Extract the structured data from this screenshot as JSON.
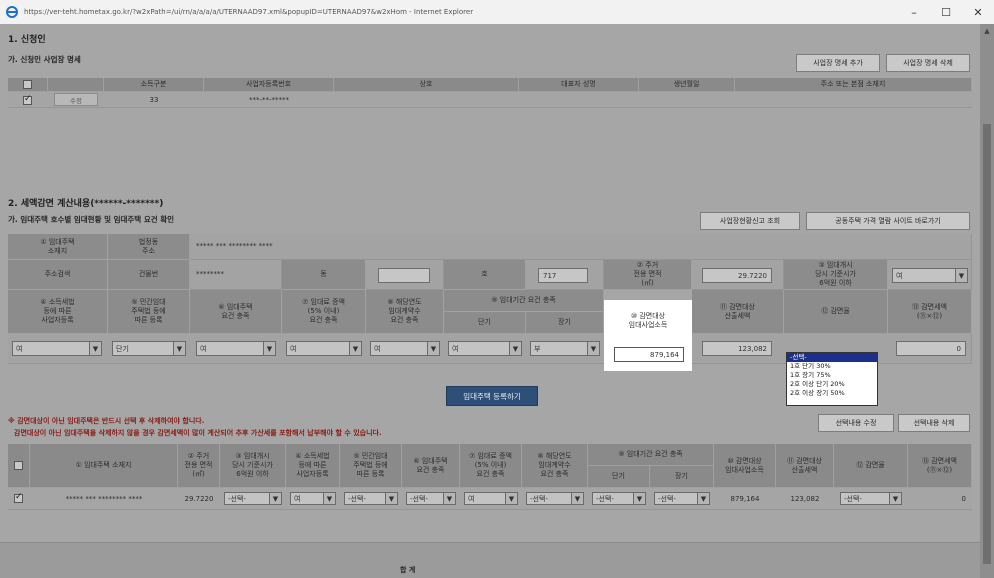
{
  "window": {
    "url": "https://ver-teht.hometax.go.kr/?w2xPath=/ui/rn/a/a/a/a/UTERNAAD97.xml&popupID=UTERNAAD97&w2xHom - Internet Explorer",
    "minimize": "–",
    "maximize": "☐",
    "close": "✕"
  },
  "section1": {
    "title": "1. 신청인",
    "subtitle": "가. 신청인 사업장 명세",
    "add_button": "사업장 명세 추가",
    "delete_button": "사업장 명세 삭제",
    "headers": [
      "소득구분",
      "사업자등록번호",
      "상호",
      "대표자 성명",
      "생년월일",
      "주소 또는 본점 소재지"
    ],
    "row": {
      "edit": "수정",
      "income_type": "33",
      "biz_no": "***-**-*****"
    }
  },
  "section2": {
    "title": "2. 세액감면 계산내용(******-*******)",
    "subtitle": "가. 임대주택 호수별 임대현황 및 임대주택 요건 확인",
    "btn_report": "사업장현황신고 조회",
    "btn_price": "공동주택 가격 열람 사이트 바로가기",
    "location_label": "① 임대주택\n소재지",
    "legal_dong_label": "법정동\n주소",
    "legal_dong_value": "***** *** ******** ****",
    "addr_search": "주소검색",
    "building_label": "건물번",
    "building_value": "********",
    "dong_label": "동",
    "ho_label": "호",
    "ho_value": "717",
    "area_label": "② 주거\n전용 면적\n(㎡)",
    "area_value": "29.7220",
    "price_label": "③ 임대개시\n당시 기준시가\n6억원 이하",
    "price_value": "여",
    "col_income_reg": "④ 소득세법\n등에 따른\n사업자등록",
    "col_rent_reg": "⑤ 민간임대\n주택법 등에\n따른 등록",
    "col_requirement": "⑥ 임대주택\n요건 충족",
    "col_rate": "⑦ 임대료 증액\n(5% 이내)\n요건 충족",
    "col_yearly": "⑧ 해당연도\n임대계약수\n요건 충족",
    "col_period": "⑨ 임대기간 요건 충족",
    "col_short": "단기",
    "col_long": "장기",
    "col_income": "⑩ 감면대상\n임대사업소득",
    "col_tax": "⑪ 감면대상\n산출세액",
    "col_reduce": "⑫ 감면율",
    "col_reduced": "⑬ 감면세액\n(⑪×⑫)",
    "v_income_reg": "여",
    "v_rent_reg": "단기",
    "v_requirement": "여",
    "v_rate": "여",
    "v_yearly": "여",
    "v_short": "여",
    "v_long": "부",
    "v_income": "879,164",
    "v_tax": "123,082",
    "v_reduced": "0",
    "dropdown": [
      "-선택-",
      "1호 단기 30%",
      "1호 장기 75%",
      "2호 이상 단기 20%",
      "2호 이상 장기 50%"
    ],
    "register_button": "임대주택 등록하기",
    "note1": "※ 감면대상이 아닌 임대주택은 반드시 선택 후 삭제하여야 합니다.",
    "note2": "감면대상이 아닌 임대주택을 삭제하지 않을 경우 감면세액이 많이 계산되어 추후 가산세를 포함해서 납부해야 할 수 있습니다.",
    "btn_edit_selection": "선택내용 수정",
    "btn_delete_selection": "선택내용 삭제"
  },
  "table2": {
    "headers": {
      "location": "① 임대주택 소재지",
      "area": "② 주거\n전용 면적\n(㎡)",
      "price": "③ 임대개시\n당시 기준시가\n6억원 이하",
      "income_reg": "④ 소득세법\n등에 따른\n사업자등록",
      "rent_reg": "⑤ 민간임대\n주택법 등에\n따른 등록",
      "requirement": "⑥ 임대주택\n요건 충족",
      "rate": "⑦ 임대료 증액\n(5% 이내)\n요건 충족",
      "yearly": "⑧ 해당연도\n임대계약수\n요건 충족",
      "period": "⑨ 임대기간 요건 충족",
      "short": "단기",
      "long": "장기",
      "income": "⑩ 감면대상\n임대사업소득",
      "tax": "⑪ 감면대상\n산출세액",
      "reduce": "⑫ 감면율",
      "reduced": "⑬ 감면세액\n(⑪×⑫)"
    },
    "row": {
      "location": "***** *** ******** ****",
      "area": "29.7220",
      "price": "-선택-",
      "income_reg": "여",
      "rent_reg": "-선택-",
      "requirement": "-선택-",
      "rate": "여",
      "yearly": "-선택-",
      "short": "-선택-",
      "long": "-선택-",
      "income": "879,164",
      "tax": "123,082",
      "reduce": "-선택-",
      "reduced": "0"
    }
  },
  "footer": {
    "total": "합 계"
  }
}
